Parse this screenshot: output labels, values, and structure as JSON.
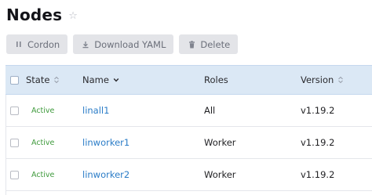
{
  "page": {
    "title": "Nodes"
  },
  "toolbar": {
    "cordon_label": "Cordon",
    "download_label": "Download YAML",
    "delete_label": "Delete"
  },
  "table": {
    "columns": {
      "state": "State",
      "name": "Name",
      "roles": "Roles",
      "version": "Version"
    },
    "rows": [
      {
        "state": "Active",
        "name": "linall1",
        "roles": "All",
        "version": "v1.19.2"
      },
      {
        "state": "Active",
        "name": "linworker1",
        "roles": "Worker",
        "version": "v1.19.2"
      },
      {
        "state": "Active",
        "name": "linworker2",
        "roles": "Worker",
        "version": "v1.19.2"
      }
    ]
  },
  "colors": {
    "link": "#2a7cc7",
    "active": "#3f9a3c",
    "header_bg": "#dbe8f5",
    "button_bg": "#e3e4e8"
  }
}
